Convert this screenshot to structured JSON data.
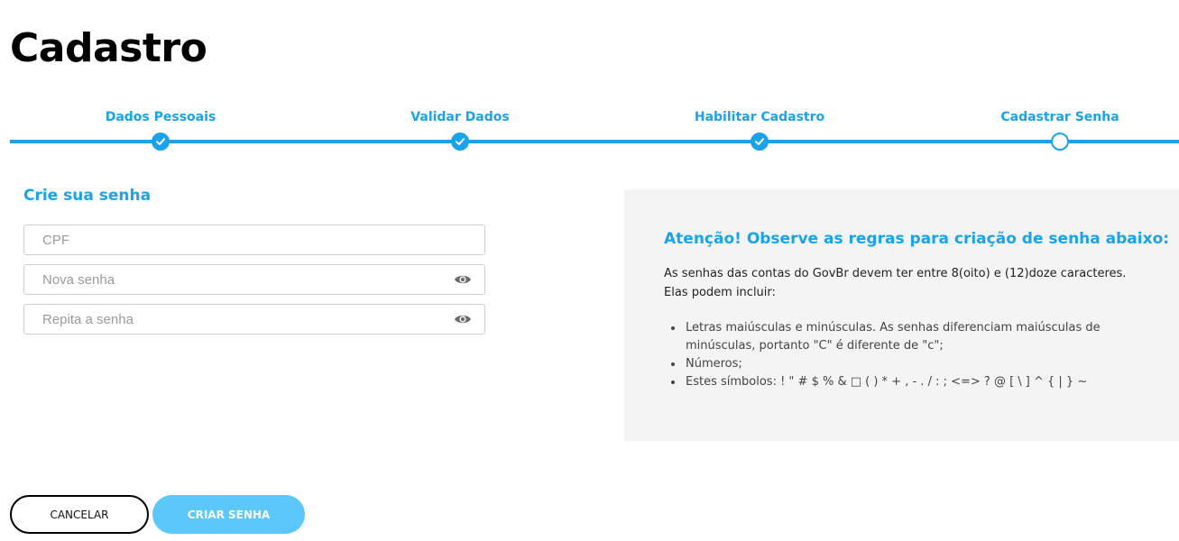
{
  "page": {
    "title": "Cadastro"
  },
  "stepper": {
    "steps": [
      {
        "label": "Dados Pessoais",
        "status": "done"
      },
      {
        "label": "Validar Dados",
        "status": "done"
      },
      {
        "label": "Habilitar Cadastro",
        "status": "done"
      },
      {
        "label": "Cadastrar Senha",
        "status": "current"
      }
    ],
    "accent_color": "#1aa3ea"
  },
  "form": {
    "title": "Crie sua senha",
    "fields": [
      {
        "name": "cpf",
        "placeholder": "CPF",
        "value": ""
      },
      {
        "name": "nova-senha",
        "placeholder": "Nova senha",
        "value": "",
        "icon": "eye-icon"
      },
      {
        "name": "repita-senha",
        "placeholder": "Repita a senha",
        "value": "",
        "icon": "eye-icon"
      }
    ]
  },
  "info": {
    "title": "Atenção! Observe as regras para criação de senha abaixo:",
    "intro": "As senhas das contas do GovBr devem ter entre 8(oito) e (12)doze caracteres. Elas podem incluir:",
    "rules": [
      "Letras maiúsculas e minúsculas. As senhas diferenciam maiúsculas de minúsculas, portanto \"C\" é diferente de \"c\";",
      "Números;",
      "Estes símbolos: ! \" # $ % & □ ( ) * + , - . / : ; <=> ? @ [ \\ ] ^ { | } ~"
    ]
  },
  "actions": {
    "cancel_label": "CANCELAR",
    "create_label": "CRIAR SENHA"
  }
}
